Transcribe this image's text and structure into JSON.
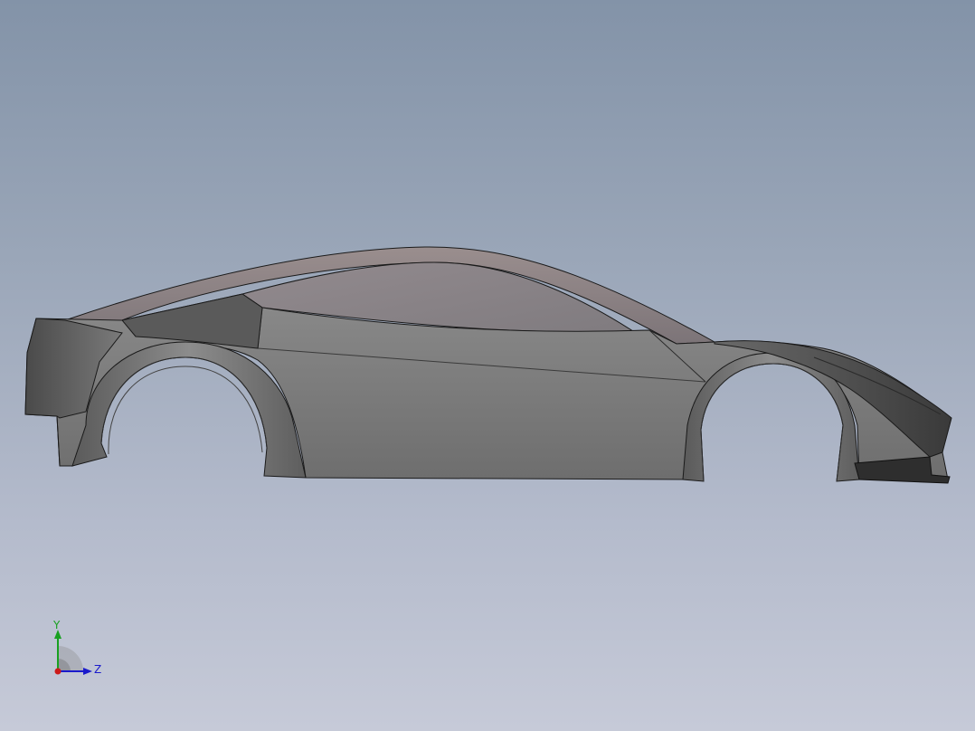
{
  "viewport": {
    "background_top": "#8393a8",
    "background_bottom": "#c6cad8"
  },
  "model": {
    "body_color": "#7a7a7a",
    "glass_color": "#8a8488",
    "edge_color": "#1a1a1a"
  },
  "triad": {
    "y_label": "Y",
    "z_label": "Z",
    "y_color": "#18a020",
    "z_color": "#1a1acc",
    "x_color": "#cc1a1a"
  }
}
